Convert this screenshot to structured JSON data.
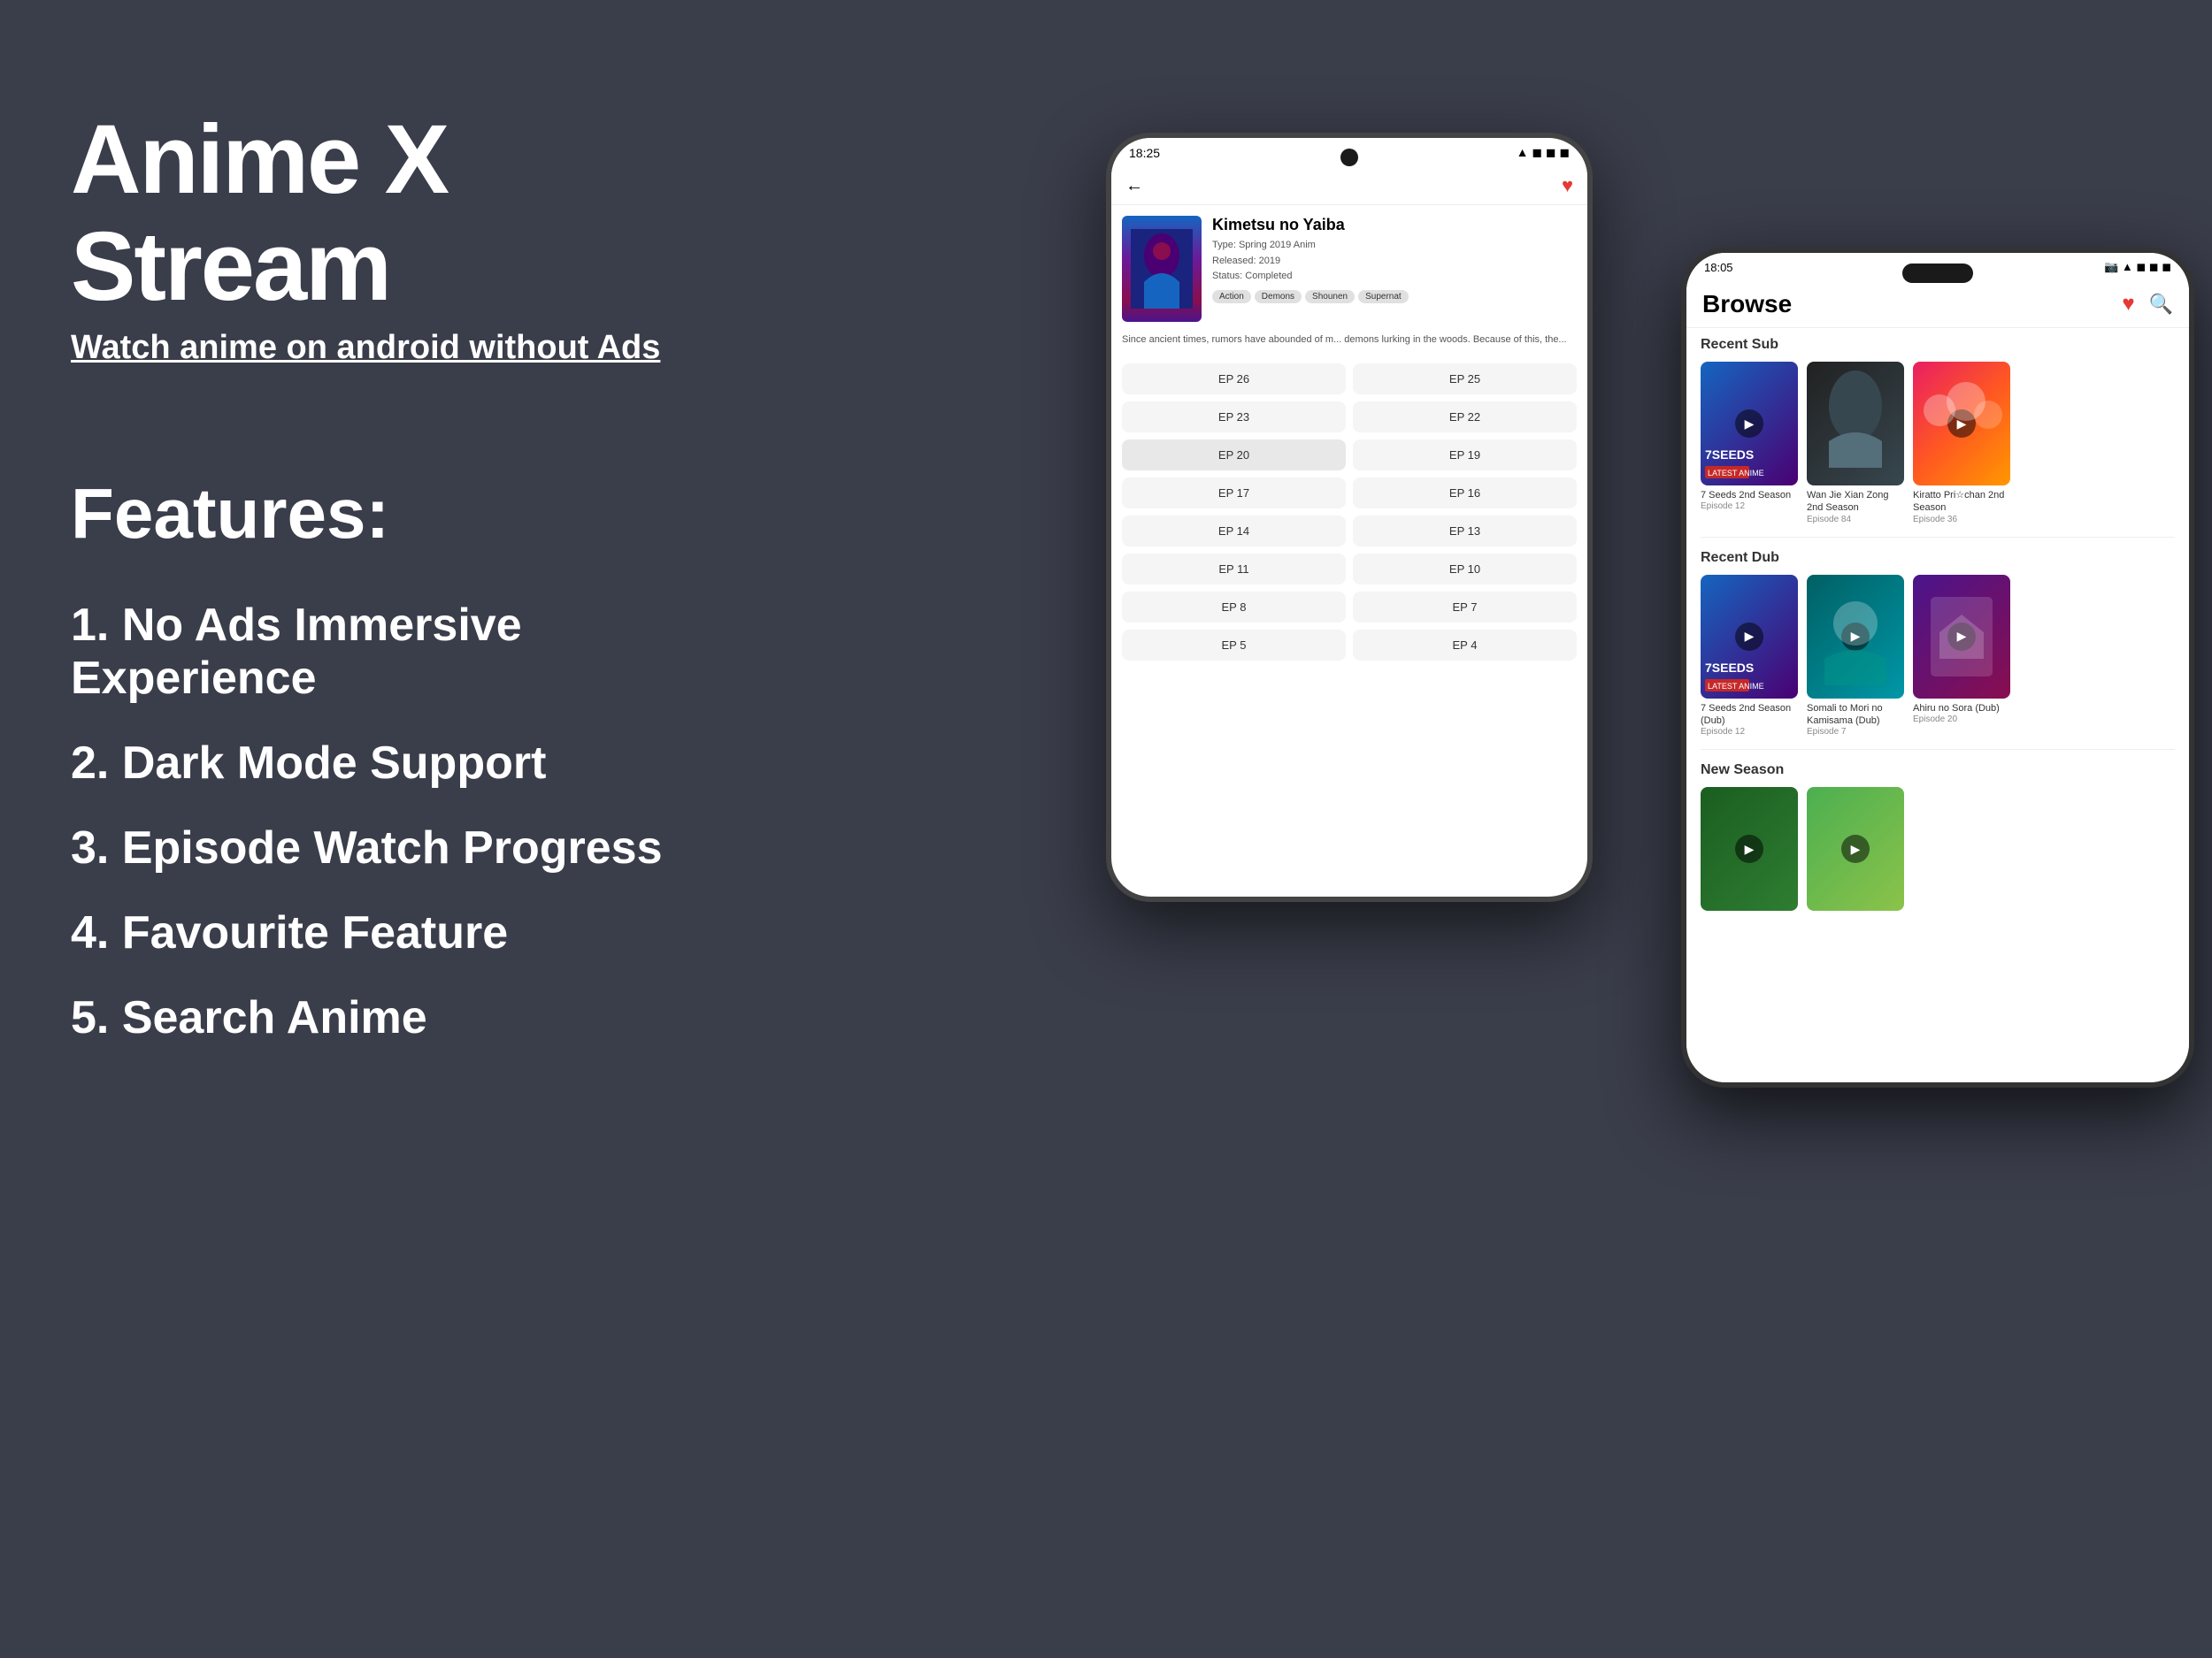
{
  "background_color": "#3a3d4a",
  "app": {
    "title": "Anime X Stream",
    "subtitle": "Watch anime on android without Ads"
  },
  "features_section": {
    "heading": "Features:",
    "items": [
      "1. No Ads Immersive Experience",
      "2. Dark Mode Support",
      "3. Episode Watch Progress",
      "4. Favourite Feature",
      "5. Search Anime"
    ]
  },
  "phone_back": {
    "status_time": "18:25",
    "anime_name": "Kimetsu no Yaiba",
    "anime_type": "Type: Spring 2019 Anim",
    "anime_released": "Released: 2019",
    "anime_status": "Status: Completed",
    "tags": [
      "Action",
      "Demons",
      "Shounen",
      "Supernat"
    ],
    "description": "Since ancient times, rumors have abounded of m... demons lurking in the woods. Because of this, the...",
    "episodes": [
      "EP 26",
      "EP 25",
      "EP 23",
      "EP 22",
      "EP 20",
      "EP 19",
      "EP 17",
      "EP 16",
      "EP 14",
      "EP 13",
      "EP 11",
      "EP 10",
      "EP 8",
      "EP 7",
      "EP 5",
      "EP 4"
    ]
  },
  "phone_front": {
    "status_time": "18:05",
    "browse_title": "Browse",
    "recent_sub_label": "Recent Sub",
    "recent_dub_label": "Recent Dub",
    "new_season_label": "New Season",
    "recent_sub": [
      {
        "title": "7 Seeds 2nd Season",
        "episode": "Episode 12"
      },
      {
        "title": "Wan Jie Xian Zong 2nd Season",
        "episode": "Episode 84"
      },
      {
        "title": "Kiratto Pri☆chan 2nd Season",
        "episode": "Episode 36"
      }
    ],
    "recent_dub": [
      {
        "title": "7 Seeds 2nd Season (Dub)",
        "episode": "Episode 12"
      },
      {
        "title": "Somali to Mori no Kamisama (Dub)",
        "episode": "Episode 7"
      },
      {
        "title": "Ahiru no Sora (Dub)",
        "episode": "Episode 20"
      }
    ]
  }
}
